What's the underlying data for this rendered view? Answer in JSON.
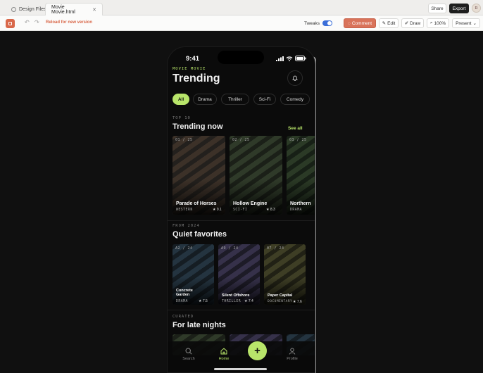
{
  "tabs": [
    {
      "label": "Design Files"
    },
    {
      "label": "Movie Movie.html"
    }
  ],
  "toolbar": {
    "reload_label": "Reload for new version",
    "tweaks_label": "Tweaks",
    "comment_label": "Comment",
    "edit_label": "Edit",
    "draw_label": "Draw",
    "zoom_label": "100%",
    "present_label": "Present",
    "share_label": "Share",
    "export_label": "Export",
    "avatar_initial": "R"
  },
  "phone": {
    "status_time": "9:41",
    "brand": "MOVIE MOVIE",
    "page_title": "Trending",
    "chips": [
      {
        "label": "All",
        "active": true
      },
      {
        "label": "Drama",
        "active": false
      },
      {
        "label": "Thriller",
        "active": false
      },
      {
        "label": "Sci-Fi",
        "active": false
      },
      {
        "label": "Comedy",
        "active": false
      }
    ],
    "sections": [
      {
        "eyebrow": "TOP 10",
        "title": "Trending now",
        "see_all": "See all",
        "cards": [
          {
            "rank": "01 / 25",
            "title": "Parade of Horses",
            "genre": "WESTERN",
            "rating": "★ 9.1",
            "colors": [
              "#3c3128",
              "#23201d"
            ]
          },
          {
            "rank": "02 / 25",
            "title": "Hollow Engine",
            "genre": "SCI-FI",
            "rating": "★ 8.3",
            "colors": [
              "#2f3a29",
              "#1b2018"
            ]
          },
          {
            "rank": "03 / 25",
            "title": "Northern",
            "genre": "DRAMA",
            "rating": "",
            "colors": [
              "#2b3a26",
              "#172016"
            ]
          }
        ]
      },
      {
        "eyebrow": "FROM 2024",
        "title": "Quiet favorites",
        "cards": [
          {
            "rank": "A2 / 24",
            "title": "Concrete Garden",
            "genre": "DRAMA",
            "rating": "★ 7.5",
            "colors": [
              "#243440",
              "#151d23"
            ]
          },
          {
            "rank": "A9 / 24",
            "title": "Silent Offshore",
            "genre": "THRILLER",
            "rating": "★ 7.4",
            "colors": [
              "#36314a",
              "#1d1b27"
            ]
          },
          {
            "rank": "07 / 24",
            "title": "Paper Capital",
            "genre": "DOCUMENTARY",
            "rating": "★ 7.6",
            "colors": [
              "#3e3e25",
              "#212115"
            ]
          }
        ]
      },
      {
        "eyebrow": "CURATED",
        "title": "For late nights"
      }
    ],
    "nav": {
      "search_label": "Search",
      "home_label": "Home",
      "add_label": "+",
      "profile_label": "Profile"
    }
  },
  "colors": {
    "accent": "#b8e56a",
    "toolbar_accent": "#d9735a"
  }
}
